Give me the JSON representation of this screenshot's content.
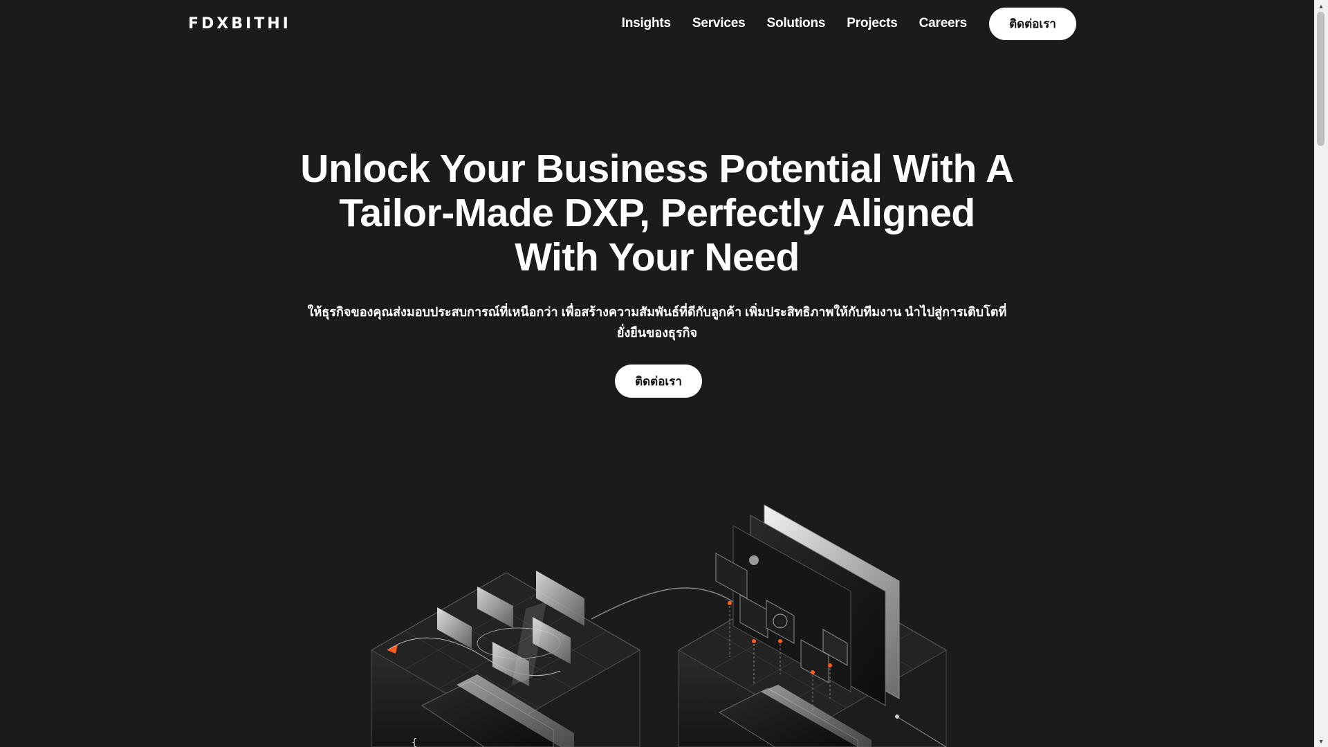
{
  "header": {
    "logo_text": "FDXBITHI",
    "nav": [
      {
        "label": "Insights"
      },
      {
        "label": "Services"
      },
      {
        "label": "Solutions"
      },
      {
        "label": "Projects"
      },
      {
        "label": "Careers"
      }
    ],
    "cta_label": "ติดต่อเรา"
  },
  "hero": {
    "title": "Unlock Your Business Potential With A Tailor-Made DXP, Perfectly Aligned With Your Need",
    "subtitle": "ให้ธุรกิจของคุณส่งมอบประสบการณ์ที่เหนือกว่า เพื่อสร้างความสัมพันธ์ที่ดีกับลูกค้า เพิ่มประสิทธิภาพให้กับทีมงาน นำไปสู่การเติบโตที่ยั่งยืนของธุรกิจ",
    "cta_label": "ติดต่อเรา"
  },
  "colors": {
    "background": "#1b1b1b",
    "text": "#ffffff",
    "button_bg": "#ffffff",
    "button_text": "#111111",
    "accent": "#ff5a1f"
  },
  "illustration": {
    "icons": [
      "isometric-cube-left-icon",
      "isometric-cube-right-icon",
      "ui-panels-icon",
      "connector-line-icon"
    ]
  }
}
